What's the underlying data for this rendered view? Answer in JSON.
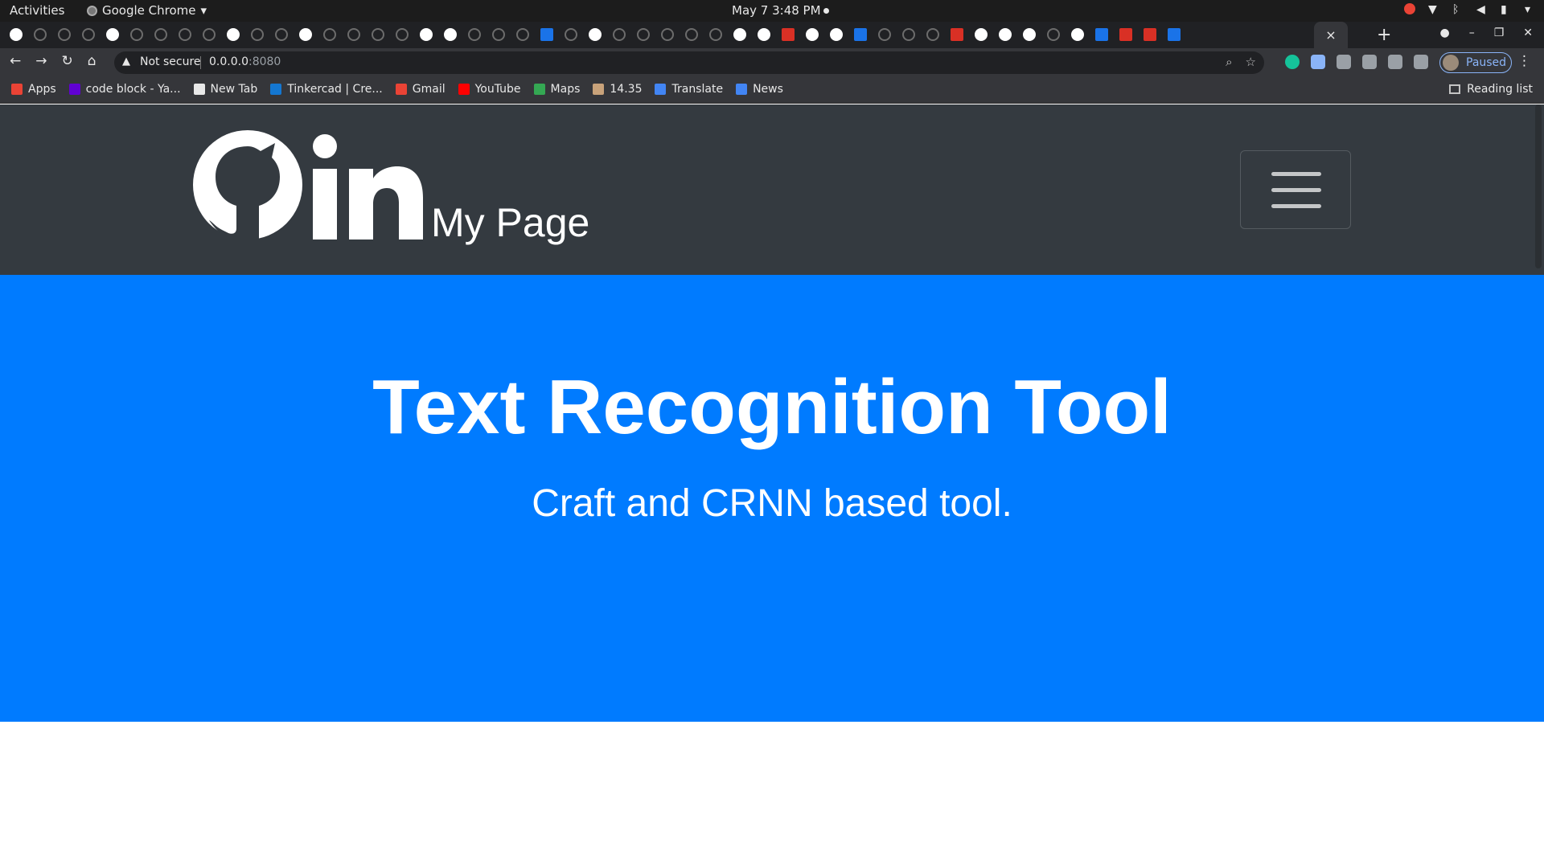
{
  "system_bar": {
    "activities": "Activities",
    "app_name": "Google Chrome",
    "clock": "May 7  3:48 PM"
  },
  "browser": {
    "active_tab_close": "×",
    "new_tab": "+",
    "security_label": "Not secure",
    "url_host": "0.0.0.0",
    "url_port": ":8080",
    "profile_status": "Paused"
  },
  "bookmarks": [
    {
      "label": "Apps",
      "color": "#ea4335"
    },
    {
      "label": "code block - Ya...",
      "color": "#6001d2"
    },
    {
      "label": "New Tab",
      "color": "#e8e8e8"
    },
    {
      "label": "Tinkercad | Cre...",
      "color": "#1477d1"
    },
    {
      "label": "Gmail",
      "color": "#ea4335"
    },
    {
      "label": "YouTube",
      "color": "#ff0000"
    },
    {
      "label": "Maps",
      "color": "#34a853"
    },
    {
      "label": "14.35",
      "color": "#c8a27a"
    },
    {
      "label": "Translate",
      "color": "#4285f4"
    },
    {
      "label": "News",
      "color": "#4285f4"
    }
  ],
  "reading_list": "Reading list",
  "page": {
    "brand": "My Page",
    "logo_text": "in",
    "hero_title": "Text Recognition Tool",
    "hero_subtitle": "Craft and CRNN based tool.",
    "colors": {
      "navbar": "#343a40",
      "hero": "#007bff"
    }
  }
}
